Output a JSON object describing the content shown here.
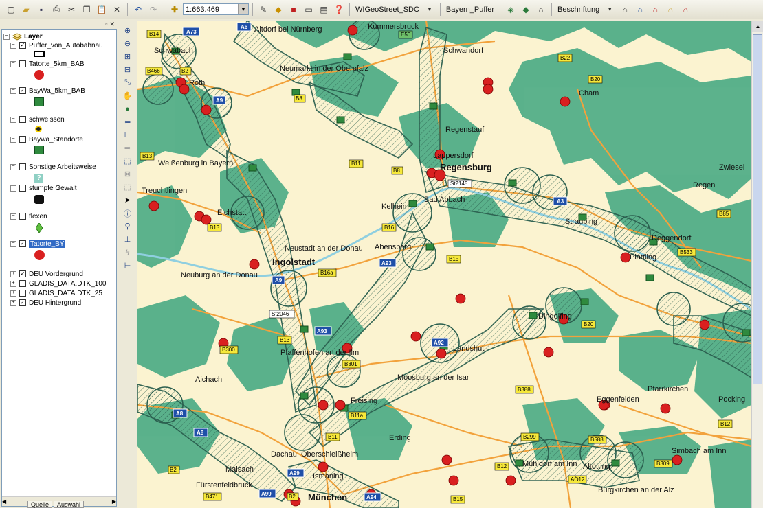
{
  "toolbar": {
    "scale_value": "1:663.469",
    "layer_dropdown": "WIGeoStreet_SDC",
    "target_layer": "Bayern_Puffer",
    "labeling_menu": "Beschriftung"
  },
  "toc": {
    "root_label": "Layer",
    "layers": [
      {
        "name": "Puffer_von_Autobahnau",
        "checked": true
      },
      {
        "name": "Tatorte_5km_BAB",
        "checked": false
      },
      {
        "name": "BayWa_5km_BAB",
        "checked": true
      },
      {
        "name": "schweissen",
        "checked": false
      },
      {
        "name": "Baywa_Standorte",
        "checked": false
      },
      {
        "name": "Sonstige Arbeitsweise",
        "checked": false
      },
      {
        "name": "stumpfe Gewalt",
        "checked": false
      },
      {
        "name": "flexen",
        "checked": false
      },
      {
        "name": "Tatorte_BY",
        "checked": true
      },
      {
        "name": "DEU Vordergrund",
        "checked": true
      },
      {
        "name": "GLADIS_DATA.DTK_100",
        "checked": false
      },
      {
        "name": "GLADIS_DATA.DTK_25",
        "checked": false
      },
      {
        "name": "DEU Hintergrund",
        "checked": true
      }
    ],
    "tab_source": "Quelle",
    "tab_selection": "Auswahl"
  },
  "map": {
    "colors": {
      "background": "#fbf3d0",
      "forest": "#3fa680",
      "road": "#f2a23c",
      "buffer": "#2b5f4f",
      "incident": "#d92020",
      "autobahn_shield": "#1f4fa8"
    },
    "cities": [
      {
        "name": "Altdorf bei Nürnberg",
        "big": false
      },
      {
        "name": "Kummersbruck",
        "big": false
      },
      {
        "name": "Schwabach",
        "big": false
      },
      {
        "name": "Schwandorf",
        "big": false
      },
      {
        "name": "Neumarkt in der Oberpfalz",
        "big": false
      },
      {
        "name": "Roth",
        "big": false
      },
      {
        "name": "Cham",
        "big": false
      },
      {
        "name": "Regenstauf",
        "big": false
      },
      {
        "name": "Lappersdorf",
        "big": false
      },
      {
        "name": "Regensburg",
        "big": true
      },
      {
        "name": "Weißenburg in Bayern",
        "big": false
      },
      {
        "name": "Zwiesel",
        "big": false
      },
      {
        "name": "Regen",
        "big": false
      },
      {
        "name": "Treuchtlingen",
        "big": false
      },
      {
        "name": "Kelheim",
        "big": false
      },
      {
        "name": "Bad Abbach",
        "big": false
      },
      {
        "name": "Eichstatt",
        "big": false
      },
      {
        "name": "Straubing",
        "big": false
      },
      {
        "name": "Deggendorf",
        "big": false
      },
      {
        "name": "Neustadt an der Donau",
        "big": false
      },
      {
        "name": "Abensberg",
        "big": false
      },
      {
        "name": "Ingolstadt",
        "big": true
      },
      {
        "name": "Plattling",
        "big": false
      },
      {
        "name": "Neuburg an der Donau",
        "big": false
      },
      {
        "name": "Dingolfing",
        "big": false
      },
      {
        "name": "Landshut",
        "big": false
      },
      {
        "name": "Pfaffenhofen an der Ilm",
        "big": false
      },
      {
        "name": "Aichach",
        "big": false
      },
      {
        "name": "Moosburg an der Isar",
        "big": false
      },
      {
        "name": "Eggenfelden",
        "big": false
      },
      {
        "name": "Pfarrkirchen",
        "big": false
      },
      {
        "name": "Freising",
        "big": false
      },
      {
        "name": "Pocking",
        "big": false
      },
      {
        "name": "Erding",
        "big": false
      },
      {
        "name": "Simbach am Inn",
        "big": false
      },
      {
        "name": "Dachau",
        "big": false
      },
      {
        "name": "Oberschleißheim",
        "big": false
      },
      {
        "name": "Mühldorf am Inn",
        "big": false
      },
      {
        "name": "Altötting",
        "big": false
      },
      {
        "name": "Maisach",
        "big": false
      },
      {
        "name": "Ismaning",
        "big": false
      },
      {
        "name": "Fürstenfeldbruck",
        "big": false
      },
      {
        "name": "München",
        "big": true
      },
      {
        "name": "Burgkirchen an der Alz",
        "big": false
      }
    ],
    "autobahn_shields": [
      "A73",
      "A6",
      "A9",
      "A3",
      "A93",
      "A9",
      "A93",
      "A92",
      "A8",
      "A8",
      "A99",
      "A99",
      "A94"
    ],
    "road_shields": [
      "B14",
      "E50",
      "B466",
      "B2",
      "B22",
      "B20",
      "B8",
      "B13",
      "B11",
      "B8",
      "B16",
      "St2145",
      "B85",
      "B13",
      "B16a",
      "B533",
      "St2046",
      "B15",
      "B20",
      "B300",
      "B13",
      "B301",
      "B388",
      "B12",
      "B11a",
      "B299",
      "B588",
      "B11",
      "B12",
      "AÖ12",
      "B309",
      "B2",
      "B471",
      "B2",
      "B15"
    ]
  }
}
